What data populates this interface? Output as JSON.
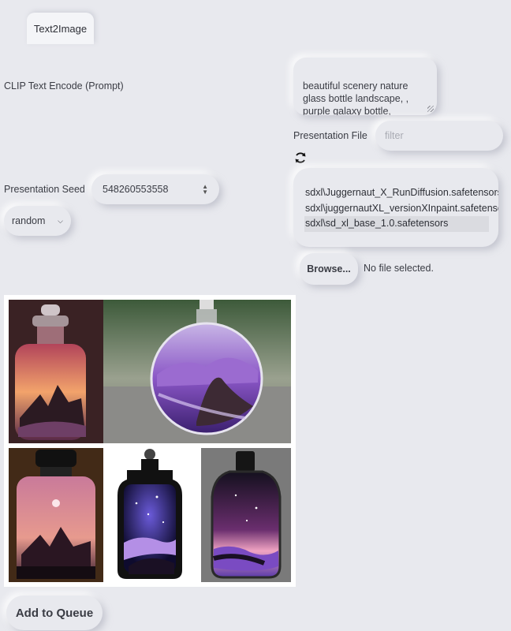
{
  "tabs": [
    {
      "label": "Text2Image",
      "active": true
    }
  ],
  "prompt": {
    "label": "CLIP Text Encode (Prompt)",
    "value": "beautiful scenery nature\nglass bottle landscape, ,\npurple galaxy bottle,"
  },
  "presentation_file": {
    "label": "Presentation File",
    "filter_placeholder": "filter",
    "refresh_icon": "refresh-icon",
    "files": [
      {
        "name": "sdxl\\Juggernaut_X_RunDiffusion.safetensors",
        "selected": false
      },
      {
        "name": "sdxl\\juggernautXL_versionXInpaint.safetensors",
        "selected": false
      },
      {
        "name": "sdxl\\sd_xl_base_1.0.safetensors",
        "selected": true
      }
    ],
    "browse_label": "Browse...",
    "no_file_text": "No file selected."
  },
  "seed": {
    "label": "Presentation Seed",
    "value": "548260553558",
    "mode": "random"
  },
  "gallery": {
    "images": [
      {
        "name": "bottle-sunset-mountains"
      },
      {
        "name": "round-flask-purple-landscape"
      },
      {
        "name": "bottle-pink-sky-moon"
      },
      {
        "name": "bottle-galaxy-waves-white"
      },
      {
        "name": "bottle-galaxy-waves-grey"
      }
    ]
  },
  "actions": {
    "queue_label": "Add to Queue"
  },
  "colors": {
    "background": "#e8e9ee",
    "accent_purple": "#7a4bc2"
  }
}
